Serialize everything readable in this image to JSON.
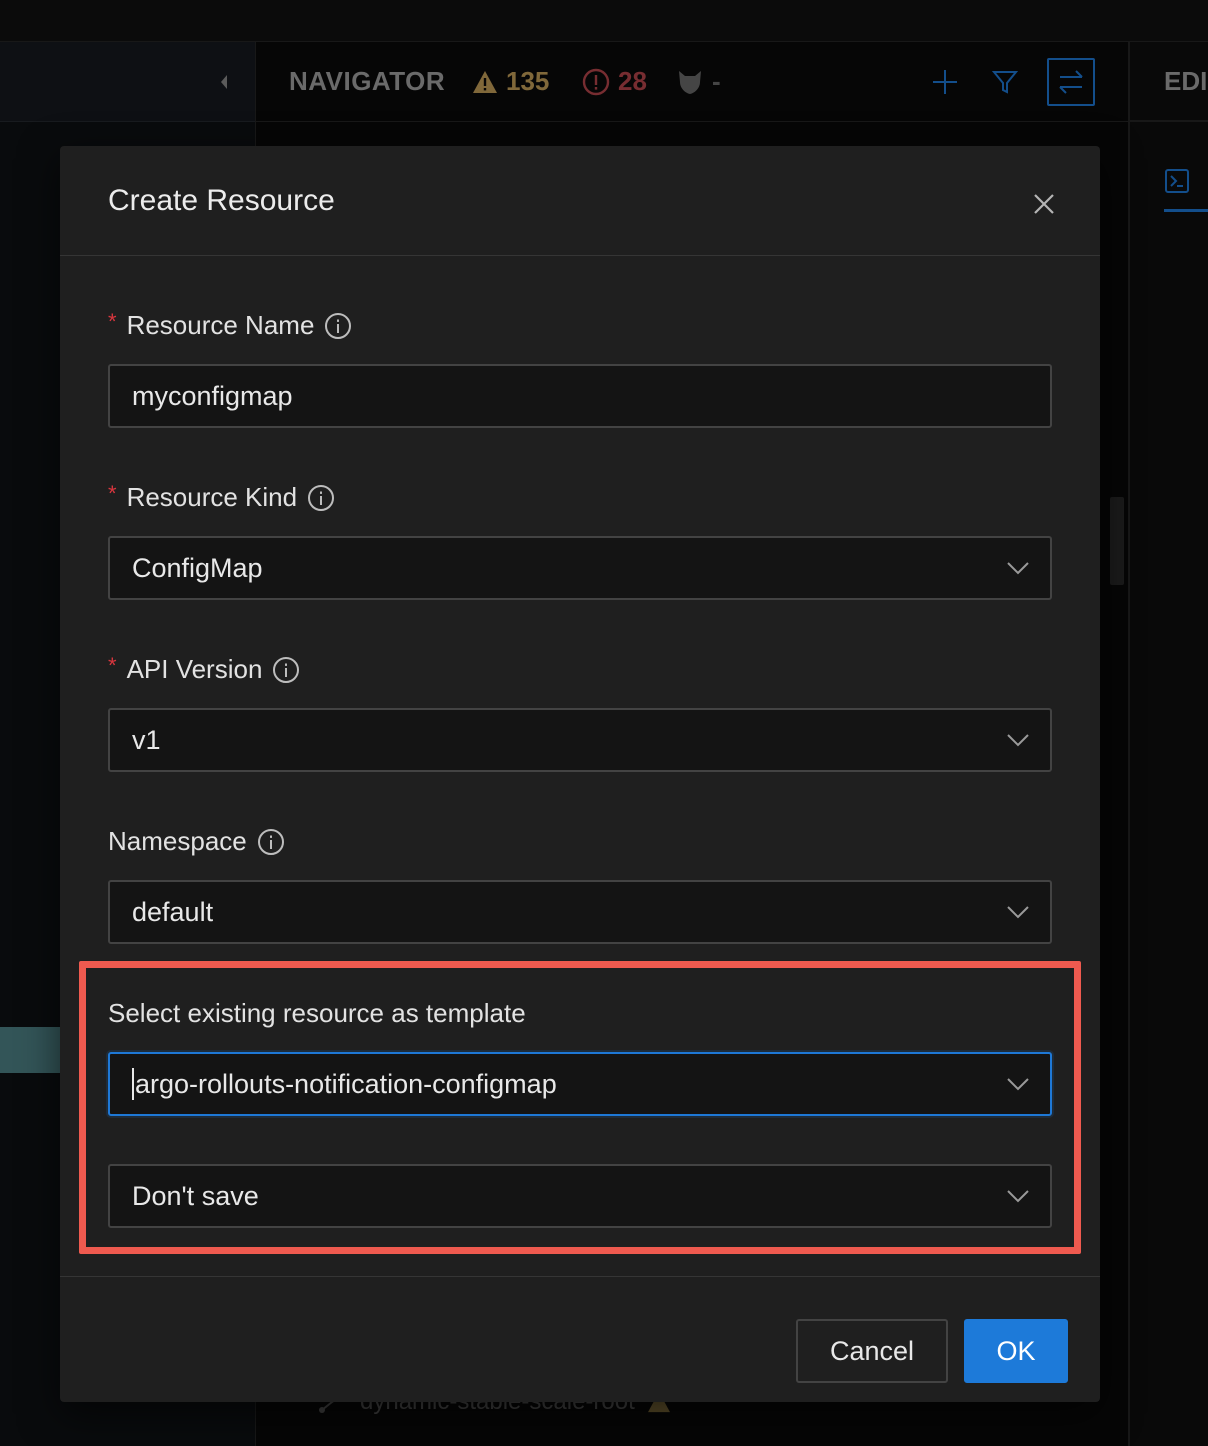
{
  "navigator": {
    "title": "NAVIGATOR",
    "warnings": "135",
    "errors": "28",
    "policy": "-"
  },
  "editor": {
    "title_partial": "EDI"
  },
  "background_rows": {
    "row1": "dynamic-stable-scale-root"
  },
  "modal": {
    "title": "Create Resource",
    "fields": {
      "resource_name": {
        "label": "Resource Name",
        "required": true,
        "value": "myconfigmap"
      },
      "resource_kind": {
        "label": "Resource Kind",
        "required": true,
        "value": "ConfigMap"
      },
      "api_version": {
        "label": "API Version",
        "required": true,
        "value": "v1"
      },
      "namespace": {
        "label": "Namespace",
        "required": false,
        "value": "default"
      },
      "template": {
        "label": "Select existing resource as template",
        "value": "argo-rollouts-notification-configmap"
      },
      "save_option": {
        "value": "Don't save"
      }
    },
    "buttons": {
      "cancel": "Cancel",
      "ok": "OK"
    }
  },
  "colors": {
    "accent": "#1d7ad9",
    "highlight": "#ef5a4f",
    "warning": "#c5a05a",
    "error": "#b7454c",
    "required": "#d9363e"
  }
}
